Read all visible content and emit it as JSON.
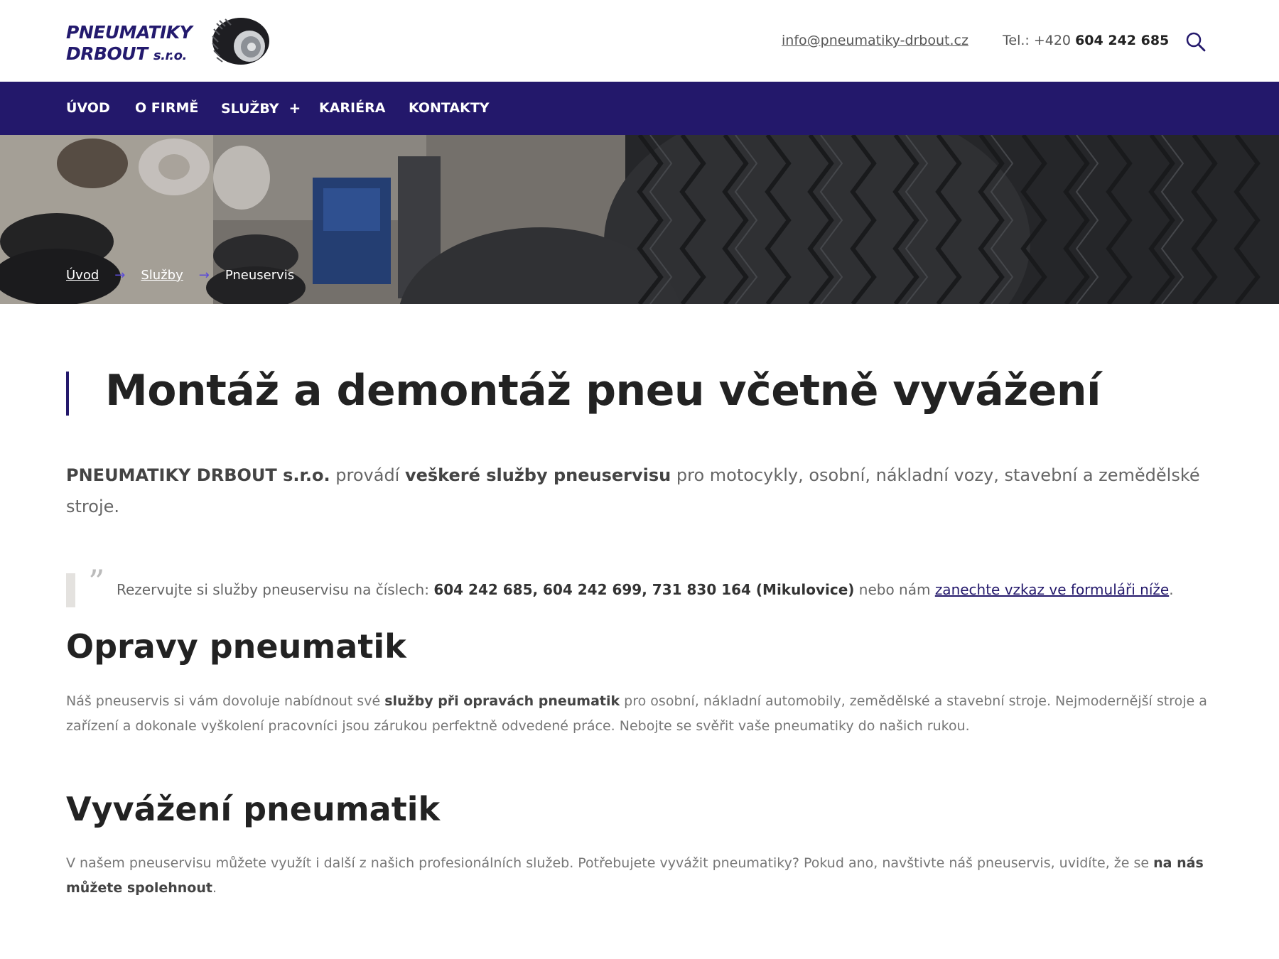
{
  "header": {
    "logo_line1": "PNEUMATIKY",
    "logo_line2": "DRBOUT",
    "logo_suffix": "s.r.o.",
    "email": "info@pneumatiky-drbout.cz",
    "tel_prefix": "Tel.: +420 ",
    "tel_number": "604 242 685",
    "search_icon": "search-icon"
  },
  "nav": {
    "items": [
      {
        "label": "ÚVOD"
      },
      {
        "label": "O FIRMĚ"
      },
      {
        "label": "SLUŽBY",
        "expand": "+"
      },
      {
        "label": "KARIÉRA"
      },
      {
        "label": "KONTAKTY"
      }
    ]
  },
  "breadcrumb": {
    "home": "Úvod",
    "services": "Služby",
    "current": "Pneuservis",
    "separator": "→"
  },
  "main": {
    "title": "Montáž a demontáž pneu včetně vyvážení",
    "lead": {
      "company": "PNEUMATIKY DRBOUT s.r.o.",
      "text1": " provádí ",
      "bold1": "veškeré služby pneuservisu",
      "text2": " pro motocykly, osobní, nákladní vozy, stavební a zemědělské stroje."
    },
    "quote": {
      "mark": "”",
      "text1": "Rezervujte si služby pneuservisu na číslech: ",
      "numbers": "604 242 685, 604 242 699, 731 830 164 (Mikulovice)",
      "text2": " nebo nám ",
      "link": "zanechte vzkaz ve formuláři níže",
      "end": "."
    },
    "section1": {
      "heading": "Opravy pneumatik",
      "text1": "Náš pneuservis si vám dovoluje nabídnout své ",
      "bold": "služby při opravách pneumatik",
      "text2": " pro osobní, nákladní automobily, zemědělské a stavební stroje. Nejmodernější stroje a zařízení a dokonale vyškolení pracovníci jsou zárukou perfektně odvedené práce. Nebojte se svěřit vaše pneumatiky do našich rukou."
    },
    "section2": {
      "heading": "Vyvážení pneumatik",
      "text1": "V našem pneuservisu můžete využít i další z našich profesionálních služeb. Potřebujete vyvážit pneumatiky? Pokud ano, navštivte náš pneuservis, uvidíte, že se ",
      "bold": "na nás můžete spolehnout",
      "end": "."
    }
  },
  "colors": {
    "brand": "#23186b",
    "heading": "#222222",
    "body_text": "#777777"
  }
}
